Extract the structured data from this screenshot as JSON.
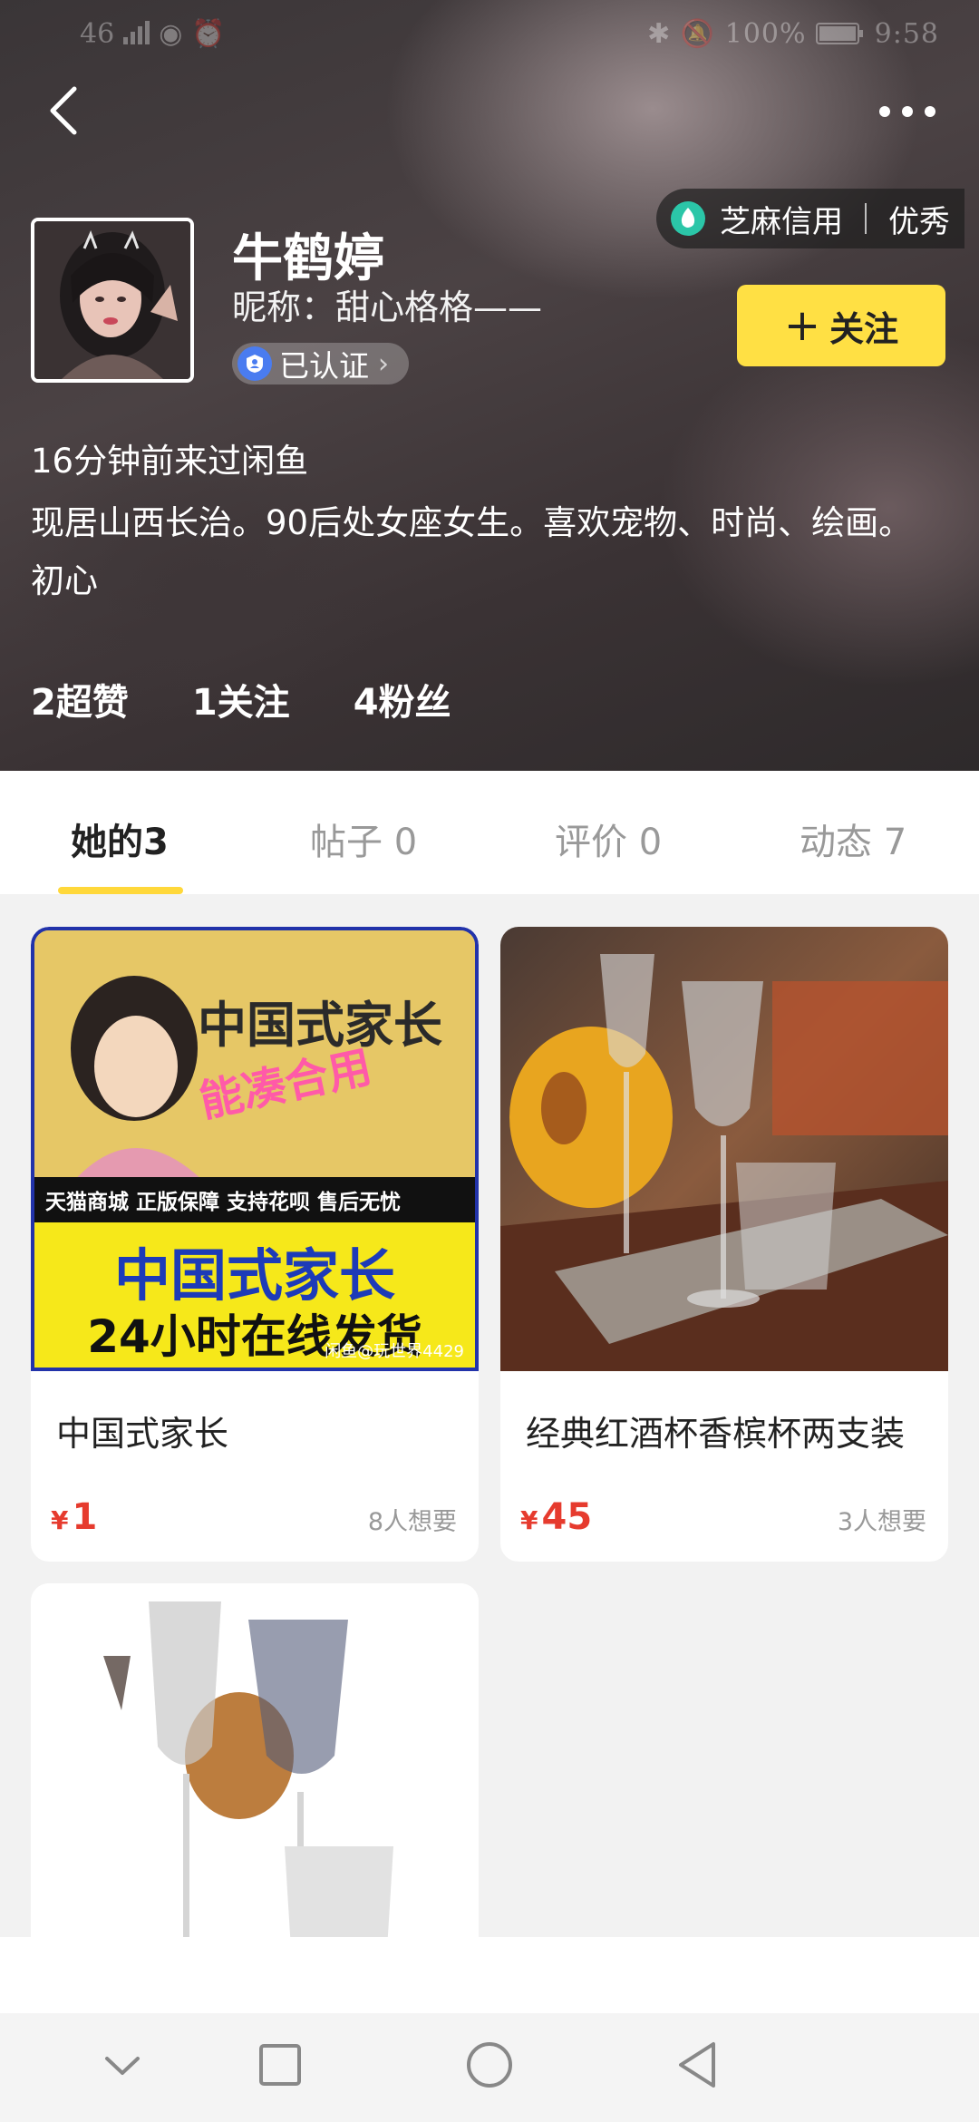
{
  "status_bar": {
    "left": "46",
    "battery": "100%",
    "time": "9:58"
  },
  "profile": {
    "name": "牛鹤婷",
    "nickname": "昵称：甜心格格——",
    "verified_label": "已认证",
    "credit_label": "芝麻信用",
    "credit_rating": "优秀",
    "follow_label": "关注",
    "last_seen": "16分钟前来过闲鱼",
    "bio": "现居山西长治。90后处女座女生。喜欢宠物、时尚、绘画。初心",
    "stats": {
      "likes": "2超赞",
      "following": "1关注",
      "fans": "4粉丝"
    }
  },
  "tabs": [
    {
      "label": "她的3"
    },
    {
      "label": "帖子 0"
    },
    {
      "label": "评价 0"
    },
    {
      "label": "动态 7"
    }
  ],
  "items": [
    {
      "title": "中国式家长",
      "price_currency": "¥",
      "price": "1",
      "wants": "8人想要",
      "image_text": {
        "top": "中国式家长",
        "overlay": "能凑合用",
        "banner": "天猫商城 正版保障 支持花呗 售后无忧",
        "big1": "中国式家长",
        "big2": "24小时在线发货",
        "watermark": "闲鱼@玩世界4429"
      }
    },
    {
      "title": "经典红酒杯香槟杯两支装",
      "price_currency": "¥",
      "price": "45",
      "wants": "3人想要"
    },
    {
      "title": ""
    }
  ],
  "colors": {
    "accent": "#ffe044",
    "price": "#e63b2e",
    "tab_indicator": "#ffd83a"
  }
}
